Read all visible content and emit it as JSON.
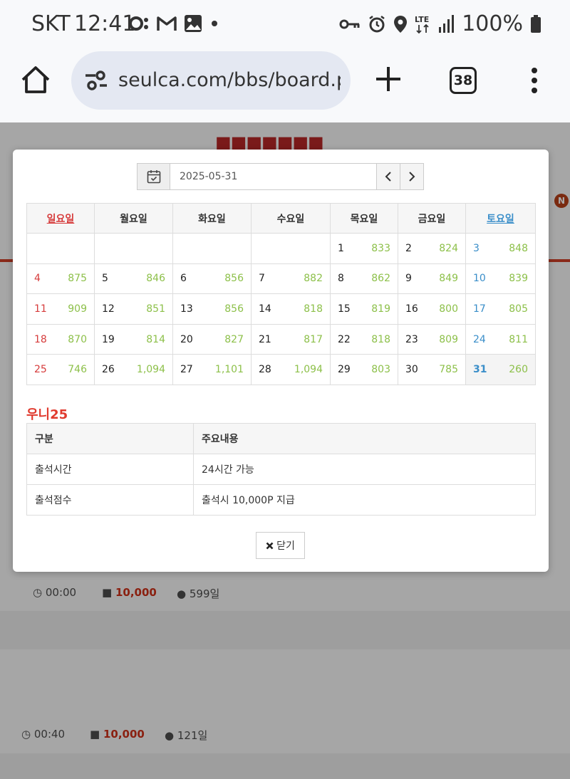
{
  "status_bar": {
    "carrier": "SKT",
    "time": "12:41",
    "battery": "100%"
  },
  "browser": {
    "url": "seulca.com/bbs/board.ph",
    "tab_count": "38"
  },
  "background_page": {
    "row1": {
      "time": "00:00",
      "points": "10,000",
      "days": "599일"
    },
    "row2": {
      "time": "00:40",
      "points": "10,000",
      "days": "121일"
    }
  },
  "modal": {
    "date_value": "2025-05-31",
    "weekdays": [
      "일요일",
      "월요일",
      "화요일",
      "수요일",
      "목요일",
      "금요일",
      "토요일"
    ],
    "weeks": [
      [
        null,
        null,
        null,
        null,
        {
          "day": "1",
          "count": "833"
        },
        {
          "day": "2",
          "count": "824"
        },
        {
          "day": "3",
          "count": "848"
        }
      ],
      [
        {
          "day": "4",
          "count": "875"
        },
        {
          "day": "5",
          "count": "846"
        },
        {
          "day": "6",
          "count": "856"
        },
        {
          "day": "7",
          "count": "882"
        },
        {
          "day": "8",
          "count": "862"
        },
        {
          "day": "9",
          "count": "849"
        },
        {
          "day": "10",
          "count": "839"
        }
      ],
      [
        {
          "day": "11",
          "count": "909"
        },
        {
          "day": "12",
          "count": "851"
        },
        {
          "day": "13",
          "count": "856"
        },
        {
          "day": "14",
          "count": "818"
        },
        {
          "day": "15",
          "count": "819"
        },
        {
          "day": "16",
          "count": "800"
        },
        {
          "day": "17",
          "count": "805"
        }
      ],
      [
        {
          "day": "18",
          "count": "870"
        },
        {
          "day": "19",
          "count": "814"
        },
        {
          "day": "20",
          "count": "827"
        },
        {
          "day": "21",
          "count": "817"
        },
        {
          "day": "22",
          "count": "818"
        },
        {
          "day": "23",
          "count": "809"
        },
        {
          "day": "24",
          "count": "811"
        }
      ],
      [
        {
          "day": "25",
          "count": "746"
        },
        {
          "day": "26",
          "count": "1,094"
        },
        {
          "day": "27",
          "count": "1,101"
        },
        {
          "day": "28",
          "count": "1,094"
        },
        {
          "day": "29",
          "count": "803"
        },
        {
          "day": "30",
          "count": "785"
        },
        {
          "day": "31",
          "count": "260"
        }
      ]
    ],
    "today": "31",
    "section_title": "우니25",
    "info_table": {
      "headers": [
        "구분",
        "주요내용"
      ],
      "rows": [
        [
          "출석시간",
          "24시간 가능"
        ],
        [
          "출석점수",
          "출석시 10,000P 지급"
        ]
      ]
    },
    "close_label": "닫기"
  },
  "colors": {
    "sunday": "#d63b3b",
    "saturday": "#3a8ec9",
    "count": "#8dc04a",
    "section_title": "#e03a2e"
  }
}
